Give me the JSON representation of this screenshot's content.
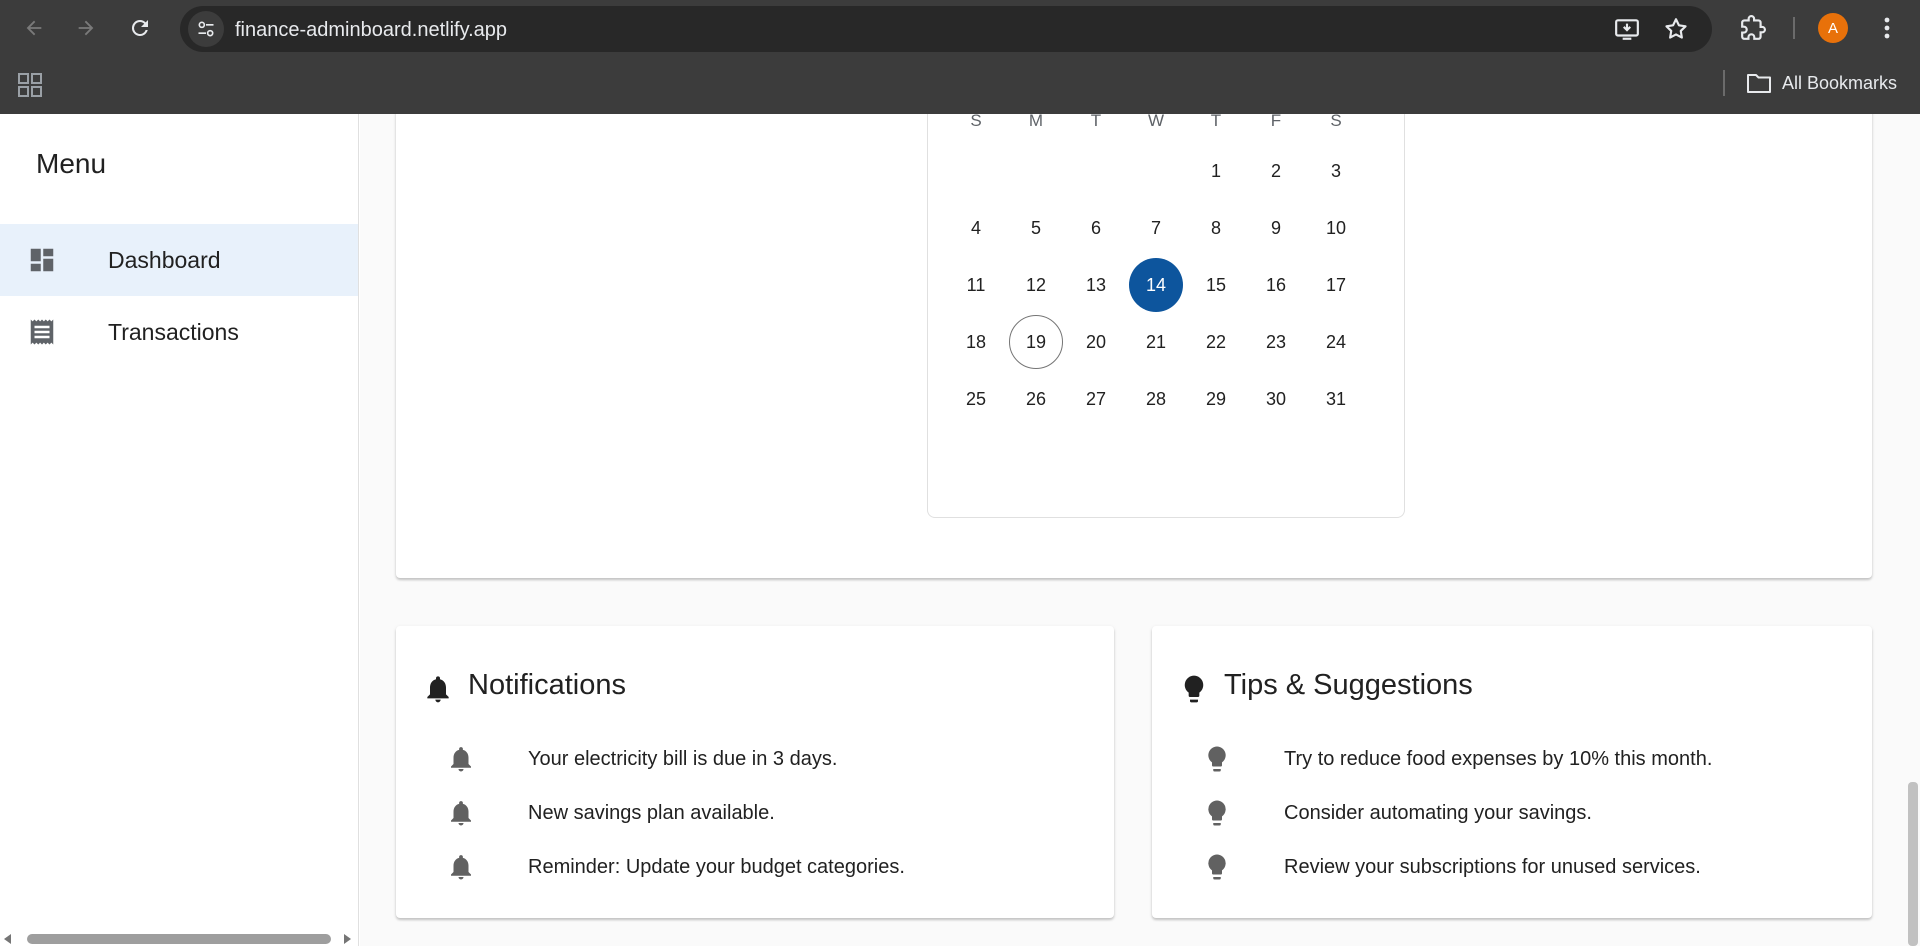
{
  "browser": {
    "url": "finance-adminboard.netlify.app",
    "profile_initial": "A",
    "all_bookmarks_label": "All Bookmarks"
  },
  "sidebar": {
    "title": "Menu",
    "items": [
      {
        "label": "Dashboard",
        "icon": "dashboard-icon",
        "active": true
      },
      {
        "label": "Transactions",
        "icon": "receipt-icon",
        "active": false
      }
    ]
  },
  "calendar": {
    "weekdays": [
      "S",
      "M",
      "T",
      "W",
      "T",
      "F",
      "S"
    ],
    "days": [
      "1",
      "2",
      "3",
      "4",
      "5",
      "6",
      "7",
      "8",
      "9",
      "10",
      "11",
      "12",
      "13",
      "14",
      "15",
      "16",
      "17",
      "18",
      "19",
      "20",
      "21",
      "22",
      "23",
      "24",
      "25",
      "26",
      "27",
      "28",
      "29",
      "30",
      "31"
    ],
    "first_weekday_index": 4,
    "selected_day": "14",
    "today_day": "19"
  },
  "notifications": {
    "title": "Notifications",
    "items": [
      "Your electricity bill is due in 3 days.",
      "New savings plan available.",
      "Reminder: Update your budget categories."
    ]
  },
  "tips": {
    "title": "Tips & Suggestions",
    "items": [
      "Try to reduce food expenses by 10% this month.",
      "Consider automating your savings.",
      "Review your subscriptions for unused services."
    ]
  },
  "colors": {
    "chrome_bg": "#3c3c3c",
    "accent": "#0d559d",
    "sidebar_active_bg": "#e8f1fb",
    "avatar_bg": "#e8710a"
  }
}
